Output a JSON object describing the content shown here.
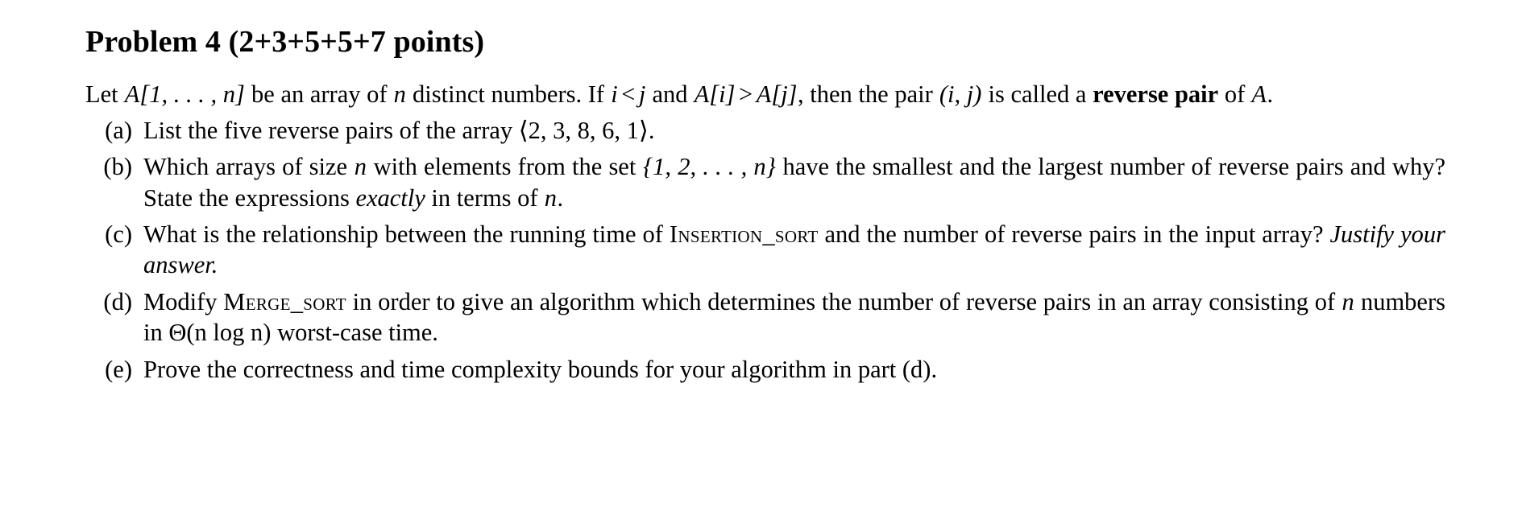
{
  "problem": {
    "title": "Problem 4 (2+3+5+5+7 points)",
    "intro": {
      "part1": "Let ",
      "array_expr": "A[1, . . . , n]",
      "part2": " be an array of ",
      "var_n": "n",
      "part3": " distinct numbers. If ",
      "cond1_i": "i",
      "cond1_rel": "<",
      "cond1_j": "j",
      "part4": " and ",
      "cond2_left": "A[i]",
      "cond2_rel": ">",
      "cond2_right": "A[j]",
      "part5": ", then the pair ",
      "pair": "(i, j)",
      "part6": " is called a ",
      "term_bold": "reverse pair",
      "part7": " of ",
      "var_A": "A",
      "part8": "."
    },
    "items": [
      {
        "label": "(a)",
        "text_before": "List the five reverse pairs of the array ",
        "array_literal": "⟨2, 3, 8, 6, 1⟩",
        "text_after": "."
      },
      {
        "label": "(b)",
        "seg1": "Which arrays of size ",
        "var1": "n",
        "seg2": " with elements from the set ",
        "set_literal": "{1, 2, . . . , n}",
        "seg3": " have the smallest and the largest number of reverse pairs and why? State the expressions ",
        "emph": "exactly",
        "seg4": " in terms of ",
        "var2": "n",
        "seg5": "."
      },
      {
        "label": "(c)",
        "seg1": "What is the relationship between the running time of ",
        "proc": "Insertion_sort",
        "seg2": " and the number of reverse pairs in the input array? ",
        "emph": "Justify your answer."
      },
      {
        "label": "(d)",
        "seg1": "Modify ",
        "proc": "Merge_sort",
        "seg2": " in order to give an algorithm which determines the number of reverse pairs in an array consisting of ",
        "var1": "n",
        "seg3": " numbers in ",
        "complexity": "Θ(n log n)",
        "seg4": " worst-case time."
      },
      {
        "label": "(e)",
        "text": "Prove the correctness and time complexity bounds for your algorithm in part (d)."
      }
    ]
  }
}
